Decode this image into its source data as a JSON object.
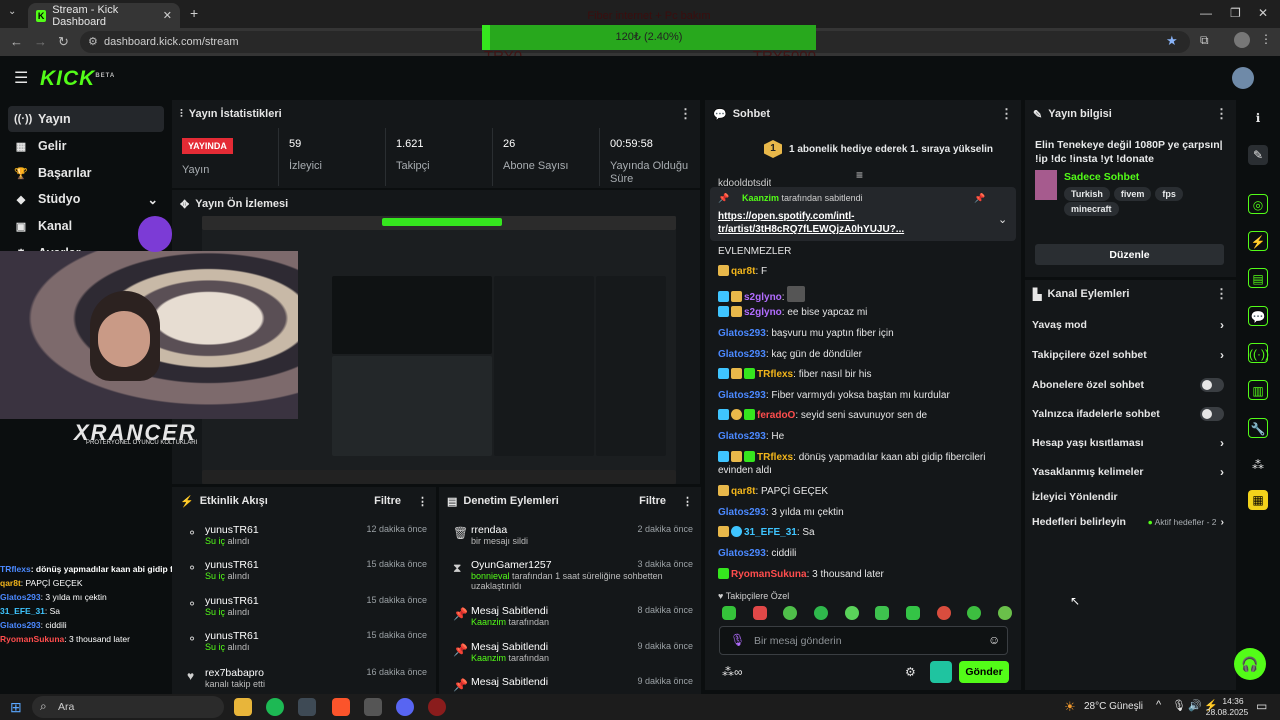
{
  "browser": {
    "tab_title": "Stream - Kick Dashboard",
    "url": "dashboard.kick.com/stream"
  },
  "donation": {
    "title": "Fiber internet + Pc bakım",
    "bar_label": "120₺ (2.40%)",
    "progress_percent": 2.4,
    "min": "TRY0",
    "max": "TRY5000"
  },
  "kick": {
    "logo": "KICK",
    "beta": "BETA"
  },
  "sidebar": {
    "items": [
      {
        "label": "Yayın",
        "icon": "broadcast-icon"
      },
      {
        "label": "Gelir",
        "icon": "revenue-icon"
      },
      {
        "label": "Başarılar",
        "icon": "trophy-icon"
      },
      {
        "label": "Stüdyo",
        "icon": "studio-icon"
      },
      {
        "label": "Kanal",
        "icon": "channel-icon"
      },
      {
        "label": "Ayarlar",
        "icon": "settings-icon"
      }
    ]
  },
  "stats": {
    "title": "Yayın İstatistikleri",
    "live_badge": "YAYINDA",
    "live_label": "Yayın",
    "viewers": "59",
    "viewers_label": "İzleyici",
    "followers": "1.621",
    "followers_label": "Takipçi",
    "subs": "26",
    "subs_label": "Abone Sayısı",
    "duration": "00:59:58",
    "duration_label": "Yayında Olduğu Süre"
  },
  "preview": {
    "title": "Yayın Ön İzlemesi"
  },
  "overlay_brand": {
    "name": "XRANCER",
    "sub": "PROTERYONEL OYUNCU KOLTUKLARI"
  },
  "activity": {
    "title": "Etkinlik Akışı",
    "filter": "Filtre",
    "items": [
      {
        "name": "yunusTR61",
        "action": "Su iç",
        "suffix": "alındı",
        "time": "12 dakika önce"
      },
      {
        "name": "yunusTR61",
        "action": "Su iç",
        "suffix": "alındı",
        "time": "15 dakika önce"
      },
      {
        "name": "yunusTR61",
        "action": "Su iç",
        "suffix": "alındı",
        "time": "15 dakika önce"
      },
      {
        "name": "yunusTR61",
        "action": "Su iç",
        "suffix": "alındı",
        "time": "15 dakika önce"
      },
      {
        "name": "rex7babapro",
        "action": "",
        "suffix": "kanalı takip etti",
        "time": "16 dakika önce"
      }
    ]
  },
  "moderation": {
    "title": "Denetim Eylemleri",
    "filter": "Filtre",
    "items": [
      {
        "name": "rrendaa",
        "detail": "bir mesajı sildi",
        "by": "",
        "time": "2 dakika önce"
      },
      {
        "name": "OyunGamer1257",
        "by": "bonnieval",
        "detail": "tarafından 1 saat süreliğine sohbetten uzaklaştırıldı",
        "time": "3 dakika önce"
      },
      {
        "name": "Mesaj Sabitlendi",
        "by": "Kaanzim",
        "detail": "tarafından",
        "time": "8 dakika önce"
      },
      {
        "name": "Mesaj Sabitlendi",
        "by": "Kaanzim",
        "detail": "tarafından",
        "time": "9 dakika önce"
      },
      {
        "name": "Mesaj Sabitlendi",
        "by": "",
        "detail": "",
        "time": "9 dakika önce"
      }
    ]
  },
  "chat": {
    "title": "Sohbet",
    "gift_rank": "1",
    "gift_banner": "1 abonelik hediye ederek 1. sıraya yükselin",
    "partial_top": "kdooldptsdjt",
    "pinned_by": "Kaanzim",
    "pinned_suffix": "tarafından sabitlendi",
    "pinned_link": "https://open.spotify.com/intl-tr/artist/3tH8cRQ7fLEWQjzA0hYUJU?...",
    "partial_line": "EVLENMEZLER",
    "messages": [
      {
        "user": "qar8t",
        "color": "#f2b51b",
        "text": "F"
      },
      {
        "user": "s2glyno",
        "color": "#b26dff",
        "text": ""
      },
      {
        "user": "s2glyno",
        "color": "#b26dff",
        "text": "ee bise yapcaz mi"
      },
      {
        "user": "Glatos293",
        "color": "#4b89ff",
        "text": "başvuru mu yaptın fiber için"
      },
      {
        "user": "Glatos293",
        "color": "#4b89ff",
        "text": "kaç gün de döndüler"
      },
      {
        "user": "TRflexs",
        "color": "#f2b51b",
        "text": "fiber nasıl bir his"
      },
      {
        "user": "Glatos293",
        "color": "#4b89ff",
        "text": "Fiber varmıydı yoksa baştan mı kurdular"
      },
      {
        "user": "feradoO",
        "color": "#ff4d4d",
        "text": "seyid seni savunuyor sen de"
      },
      {
        "user": "Glatos293",
        "color": "#4b89ff",
        "text": "He"
      },
      {
        "user": "TRflexs",
        "color": "#f2b51b",
        "text": "dönüş yapmadılar kaan abi gidip fibercileri evinden aldı"
      },
      {
        "user": "qar8t",
        "color": "#f2b51b",
        "text": "PAPÇİ GEÇEK"
      },
      {
        "user": "Glatos293",
        "color": "#4b89ff",
        "text": "3 yılda mı çektin"
      },
      {
        "user": "31_EFE_31",
        "color": "#3fc5ff",
        "text": "Sa"
      },
      {
        "user": "Glatos293",
        "color": "#4b89ff",
        "text": "ciddili"
      },
      {
        "user": "RyomanSukuna",
        "color": "#ff4d4d",
        "text": "3 thousand later"
      }
    ],
    "emote_label": "Takipçilere Özel",
    "input_placeholder": "Bir mesaj gönderin",
    "send": "Gönder"
  },
  "stream_info": {
    "title": "Yayın bilgisi",
    "stream_title": "Elin Tenekeye değil 1080P ye çarpsın| !ip !dc !insta !yt !donate",
    "category": "Sadece Sohbet",
    "tags": [
      "Turkish",
      "fivem",
      "fps",
      "minecraft"
    ],
    "edit": "Düzenle"
  },
  "channel_actions": {
    "title": "Kanal Eylemleri",
    "slow_mode": "Yavaş mod",
    "followers_only": "Takipçilere özel sohbet",
    "subs_only": "Abonelere özel sohbet",
    "emotes_only": "Yalnızca ifadelerle sohbet",
    "account_age": "Hesap yaşı kısıtlaması",
    "banned_words": "Yasaklanmış kelimeler",
    "raid": "İzleyici Yönlendir",
    "goals": "Hedefleri belirleyin",
    "goals_active": "Aktif hedefler - 2"
  },
  "chat_overlay": [
    {
      "user": "TRflexs",
      "text": ": dönüş yapmadılar kaan abi gidip fibercileri evinden aldı"
    },
    {
      "user": "qar8t",
      "text": ": PAPÇİ GEÇEK"
    },
    {
      "user": "Glatos293",
      "text": ": 3 yılda mı çektin"
    },
    {
      "user": "31_EFE_31",
      "text": ": Sa"
    },
    {
      "user": "Glatos293",
      "text": ": ciddili"
    },
    {
      "user": "RyomanSukuna",
      "text": ": 3 thousand later"
    }
  ],
  "taskbar": {
    "search": "Ara",
    "weather": "28°C  Güneşli",
    "time": "14:36",
    "date": "28.08.2025"
  }
}
